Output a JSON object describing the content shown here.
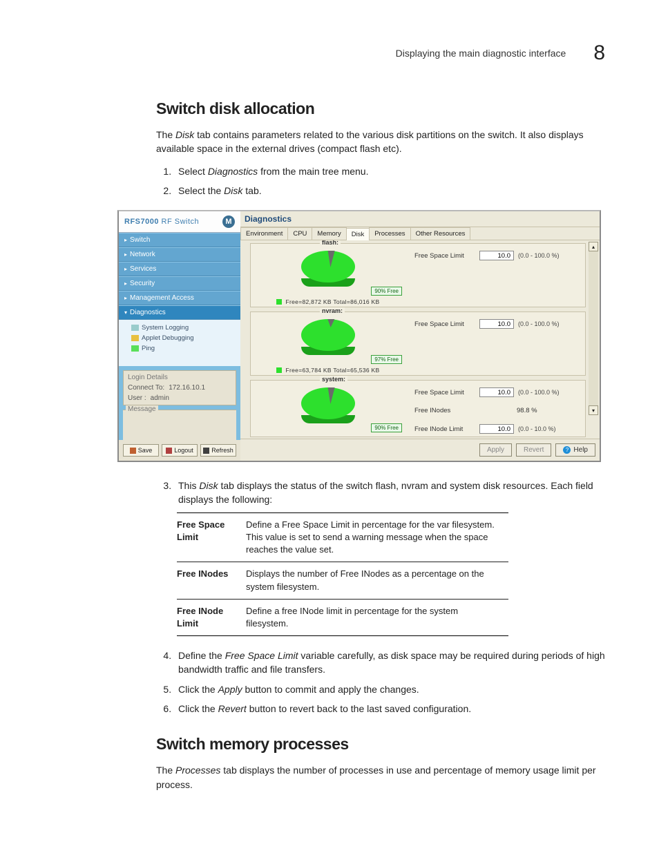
{
  "header": {
    "label": "Displaying the main diagnostic interface",
    "number": "8"
  },
  "sec1": {
    "title": "Switch disk allocation",
    "intro_a": "The ",
    "intro_em1": "Disk",
    "intro_b": " tab contains parameters related to the various disk partitions on the switch. It also displays available space in the external drives (compact flash etc).",
    "s1a": "Select ",
    "s1em": "Diagnostics",
    "s1b": " from the main tree menu.",
    "s2a": "Select the ",
    "s2em": "Disk",
    "s2b": " tab.",
    "s3a": "This ",
    "s3em": "Disk",
    "s3b": " tab displays the status of the switch flash, nvram and system disk resources. Each field displays the following:",
    "s4a": "Define the ",
    "s4em": "Free Space Limit",
    "s4b": " variable carefully, as disk space may be required during periods of high bandwidth traffic and file transfers.",
    "s5a": "Click the ",
    "s5em": "Apply",
    "s5b": " button to commit and apply the changes.",
    "s6a": "Click the ",
    "s6em": "Revert",
    "s6b": " button to revert back to the last saved configuration."
  },
  "table": {
    "r1k": "Free Space Limit",
    "r1v": "Define a Free Space Limit in percentage for the var filesystem. This value is set to send a warning message when the space reaches the value set.",
    "r2k": "Free INodes",
    "r2v": "Displays the number of Free INodes as a percentage on the system filesystem.",
    "r3k": "Free INode Limit",
    "r3v": "Define a free INode limit in percentage for the system filesystem."
  },
  "sec2": {
    "title": "Switch memory processes",
    "p_a": "The ",
    "p_em": "Processes",
    "p_b": " tab displays the number of processes in use and percentage of memory usage limit per process."
  },
  "gui": {
    "brand_a": "RFS",
    "brand_b": "7000",
    "brand_c": " RF Switch",
    "brand_logo": "M",
    "nav": {
      "n1": "Switch",
      "n2": "Network",
      "n3": "Services",
      "n4": "Security",
      "n5": "Management Access",
      "n6": "Diagnostics",
      "sub1": "System Logging",
      "sub2": "Applet Debugging",
      "sub3": "Ping"
    },
    "login": {
      "title": "Login Details",
      "l1": "Connect To:",
      "v1": "172.16.10.1",
      "l2": "User :",
      "v2": "admin"
    },
    "msg": "Message",
    "buttons": {
      "save": "Save",
      "logout": "Logout",
      "refresh": "Refresh"
    },
    "title": "Diagnostics",
    "tabs": {
      "t1": "Environment",
      "t2": "CPU",
      "t3": "Memory",
      "t4": "Disk",
      "t5": "Processes",
      "t6": "Other Resources"
    },
    "footer": {
      "apply": "Apply",
      "revert": "Revert",
      "help": "Help"
    },
    "fields": {
      "fsl": "Free Space Limit",
      "fin": "Free INodes",
      "fil": "Free INode Limit"
    },
    "range": "(0.0 - 100.0 %)",
    "range10": "(0.0 - 10.0 %)",
    "flash": {
      "name": "flash:",
      "badge": "90% Free",
      "legend": "Free=82,872 KB     Total=86,016 KB",
      "val": "10.0"
    },
    "nvram": {
      "name": "nvram:",
      "badge": "97% Free",
      "legend": "Free=63,784 KB     Total=65,536 KB",
      "val": "10.0"
    },
    "system": {
      "name": "system:",
      "badge": "90% Free",
      "val": "10.0",
      "inodes": "98.8  %",
      "ival": "10.0"
    }
  }
}
